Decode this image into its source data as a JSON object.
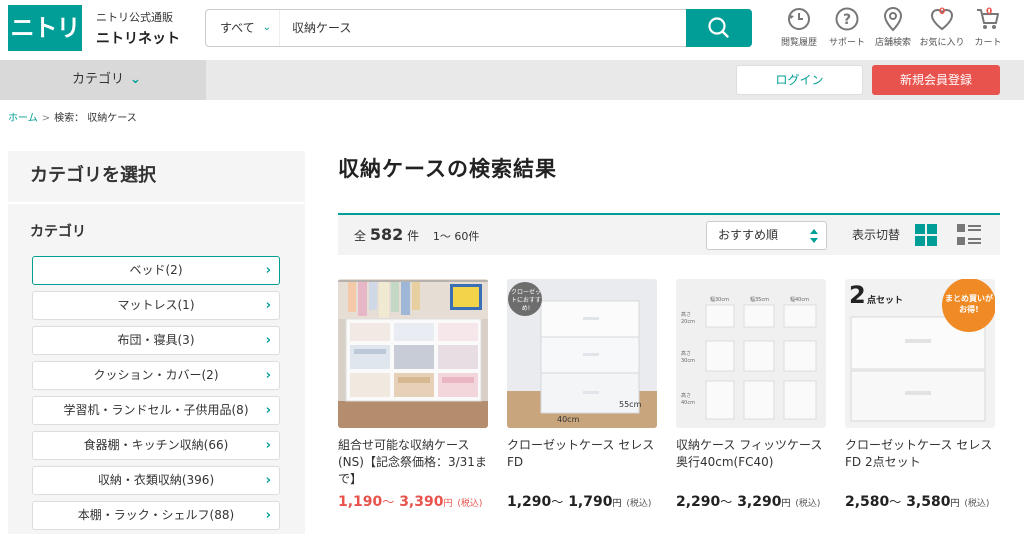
{
  "header": {
    "logo_text": "ニトリ",
    "brand_sub": "ニトリ公式通販",
    "brand_main": "ニトリネット",
    "search_scope": "すべて",
    "search_query": "収納ケース",
    "icons": [
      {
        "icon": "history-icon",
        "label": "閲覧履歴"
      },
      {
        "icon": "help-icon",
        "label": "サポート"
      },
      {
        "icon": "location-icon",
        "label": "店舗検索"
      },
      {
        "icon": "heart-icon",
        "label": "お気に入り",
        "badge": "0"
      },
      {
        "icon": "cart-icon",
        "label": "カート",
        "badge": "0"
      }
    ]
  },
  "nav": {
    "category_label": "カテゴリ",
    "login_label": "ログイン",
    "register_label": "新規会員登録"
  },
  "breadcrumb": {
    "home": "ホーム",
    "separator": ">",
    "current": "検索： 収納ケース"
  },
  "sidebar": {
    "title": "カテゴリを選択",
    "subtitle": "カテゴリ",
    "items": [
      "ベッド(2)",
      "マットレス(1)",
      "布団・寝具(3)",
      "クッション・カバー(2)",
      "学習机・ランドセル・子供用品(8)",
      "食器棚・キッチン収納(66)",
      "収納・衣類収納(396)",
      "本棚・ラック・シェルフ(88)"
    ]
  },
  "results": {
    "title": "収納ケースの検索結果",
    "count_prefix": "全",
    "count": "582",
    "count_suffix": "件",
    "range": "1～ 60件",
    "sort_value": "おすすめ順",
    "view_label": "表示切替"
  },
  "products": [
    {
      "name": "組合せ可能な収納ケース(NS)【記念祭価格：3/31まで】",
      "price_from": "1,190",
      "price_to": "3,390",
      "yen": "円",
      "tax": "(税込)",
      "sale": true
    },
    {
      "name": "クローゼットケース セレスFD",
      "price_from": "1,290",
      "price_to": "1,790",
      "yen": "円",
      "tax": "(税込)",
      "sale": false,
      "badge": "クローゼットにおすすめ!",
      "dim_a": "40cm",
      "dim_b": "55cm"
    },
    {
      "name": "収納ケース フィッツケース奥行40cm(FC40)",
      "price_from": "2,290",
      "price_to": "3,290",
      "yen": "円",
      "tax": "(税込)",
      "sale": false,
      "widths": [
        "幅30cm",
        "幅35cm",
        "幅40cm"
      ],
      "heights": [
        "高さ20cm",
        "高さ30cm",
        "高さ40cm"
      ]
    },
    {
      "name": "クローゼットケース セレスFD 2点セット",
      "price_from": "2,580",
      "price_to": "3,580",
      "yen": "円",
      "tax": "(税込)",
      "sale": false,
      "set_num": "2",
      "set_text": "点セット",
      "promo": "まとめ買いがお得!"
    }
  ],
  "colors": {
    "brand": "#009e96",
    "accent": "#e8534d"
  }
}
